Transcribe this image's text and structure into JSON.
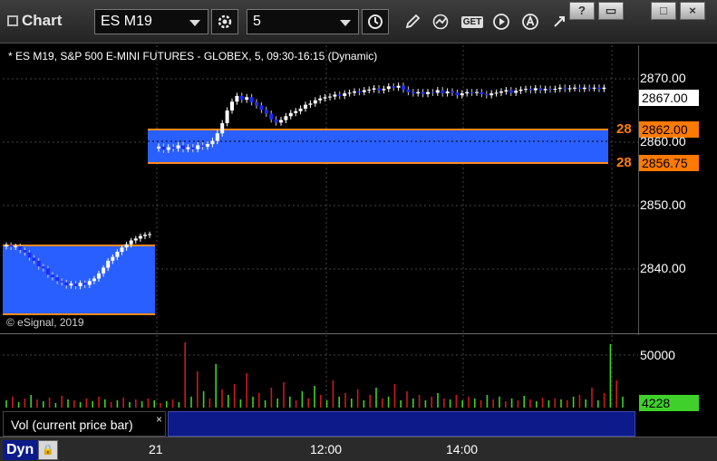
{
  "window": {
    "title": "Chart",
    "symbol": "ES M19",
    "interval": "5",
    "buttons": {
      "help": "?",
      "restore": "▭",
      "maximize": "□",
      "close": "×"
    }
  },
  "chart": {
    "header": "* ES M19, S&P 500 E-MINI FUTURES - GLOBEX, 5, 09:30-16:15 (Dynamic)",
    "watermark": "© eSignal, 2019",
    "price_ticks": [
      "2870.00",
      "2860.00",
      "2850.00",
      "2840.00"
    ],
    "last_price": "2867.00",
    "zone_upper": "2862.00",
    "zone_lower": "2856.75",
    "edge_marker_1": "28",
    "edge_marker_2": "28",
    "colors": {
      "zone": "#2a5fff",
      "zone_line": "#ff8a1f",
      "up_candle": "#ffffff",
      "down_candle": "#1b2bff",
      "badge_orange": "#ff7a00"
    }
  },
  "volume": {
    "label": "Vol (current price bar)",
    "close": "×",
    "tick_50000": "50000",
    "current": "4228"
  },
  "time_axis": [
    "21",
    "12:00",
    "14:00"
  ],
  "footer": {
    "tab": "Dyn"
  }
}
